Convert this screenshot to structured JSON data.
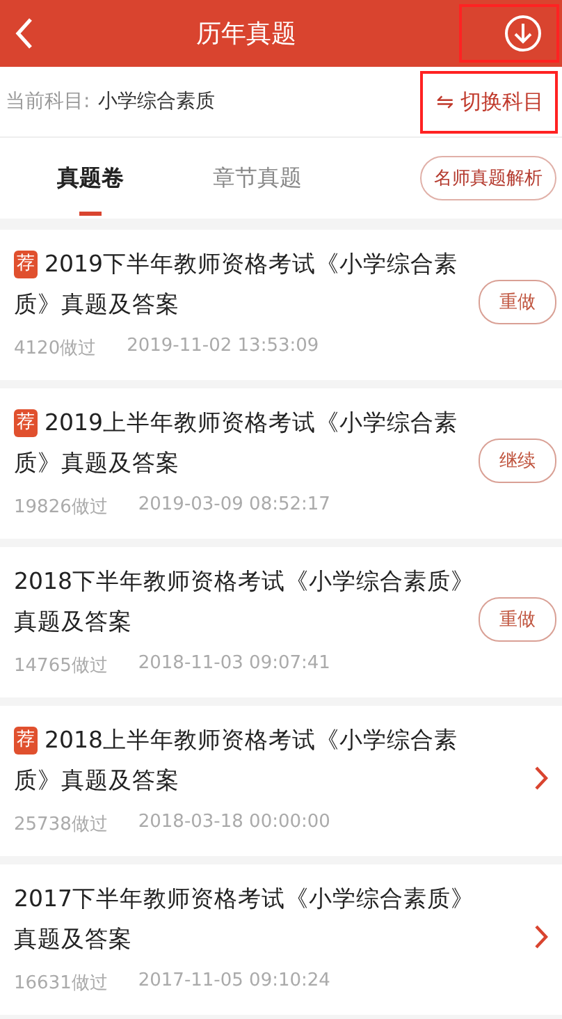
{
  "header": {
    "title": "历年真题"
  },
  "subject": {
    "label": "当前科目:",
    "value": "小学综合素质",
    "switch": "⇋ 切换科目"
  },
  "tabs": [
    {
      "label": "真题卷",
      "selected": true
    },
    {
      "label": "章节真题",
      "selected": false
    }
  ],
  "analysis_button": "名师真题解析",
  "papers": [
    {
      "badge": "荐",
      "title": "2019下半年教师资格考试《小学综合素质》真题及答案",
      "count": "4120做过",
      "time": "2019-11-02 13:53:09",
      "kind": "button",
      "action": "重做"
    },
    {
      "badge": "荐",
      "title": "2019上半年教师资格考试《小学综合素质》真题及答案",
      "count": "19826做过",
      "time": "2019-03-09 08:52:17",
      "kind": "button",
      "action": "继续"
    },
    {
      "title": "2018下半年教师资格考试《小学综合素质》真题及答案",
      "count": "14765做过",
      "time": "2018-11-03 09:07:41",
      "kind": "button",
      "action": "重做"
    },
    {
      "badge": "荐",
      "title": "2018上半年教师资格考试《小学综合素质》真题及答案",
      "count": "25738做过",
      "time": "2018-03-18 00:00:00",
      "kind": "arrow"
    },
    {
      "title": "2017下半年教师资格考试《小学综合素质》真题及答案",
      "count": "16631做过",
      "time": "2017-11-05 09:10:24",
      "kind": "arrow"
    }
  ]
}
